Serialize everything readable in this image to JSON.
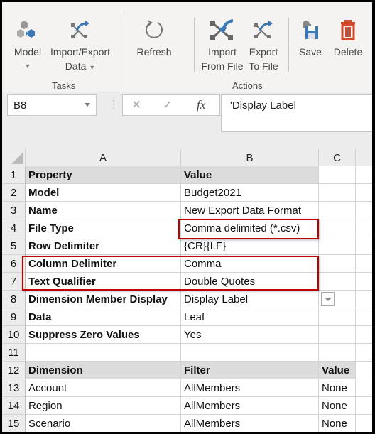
{
  "ribbon": {
    "buttons": [
      {
        "label1": "Model",
        "label2": "",
        "dropdown": true,
        "icon": "cubes-icon"
      },
      {
        "label1": "Import/Export",
        "label2": "Data",
        "dropdown": true,
        "icon": "import-export-icon"
      },
      {
        "label1": "Refresh",
        "label2": "",
        "icon": "refresh-icon"
      },
      {
        "label1": "Import",
        "label2": "From File",
        "icon": "import-file-icon"
      },
      {
        "label1": "Export",
        "label2": "To File",
        "icon": "export-file-icon"
      },
      {
        "label1": "Save",
        "label2": "",
        "icon": "save-icon"
      },
      {
        "label1": "Delete",
        "label2": "",
        "icon": "trash-icon"
      }
    ],
    "groups": [
      "Tasks",
      "Actions"
    ]
  },
  "formula_bar": {
    "name_box": "B8",
    "formula": "'Display Label"
  },
  "columns": [
    "A",
    "B",
    "C"
  ],
  "rows": [
    {
      "n": "1",
      "a": "Property",
      "b": "Value",
      "c": "",
      "header": true
    },
    {
      "n": "2",
      "a": "Model",
      "b": "Budget2021",
      "c": ""
    },
    {
      "n": "3",
      "a": "Name",
      "b": "New Export Data Format",
      "c": ""
    },
    {
      "n": "4",
      "a": "File Type",
      "b": "Comma delimited (*.csv)",
      "c": ""
    },
    {
      "n": "5",
      "a": "Row Delimiter",
      "b": "{CR}{LF}",
      "c": ""
    },
    {
      "n": "6",
      "a": "Column Delimiter",
      "b": "Comma",
      "c": ""
    },
    {
      "n": "7",
      "a": "Text Qualifier",
      "b": "Double Quotes",
      "c": ""
    },
    {
      "n": "8",
      "a": "Dimension Member Display",
      "b": "Display Label",
      "c": ""
    },
    {
      "n": "9",
      "a": "Data",
      "b": "Leaf",
      "c": ""
    },
    {
      "n": "10",
      "a": "Suppress Zero Values",
      "b": "Yes",
      "c": ""
    },
    {
      "n": "11",
      "a": "",
      "b": "",
      "c": ""
    },
    {
      "n": "12",
      "a": "Dimension",
      "b": "Filter",
      "c": "Value",
      "header": true
    },
    {
      "n": "13",
      "a": "Account",
      "b": "AllMembers",
      "c": "None",
      "plain": true
    },
    {
      "n": "14",
      "a": "Region",
      "b": "AllMembers",
      "c": "None",
      "plain": true
    },
    {
      "n": "15",
      "a": "Scenario",
      "b": "AllMembers",
      "c": "None",
      "plain": true
    }
  ],
  "colors": {
    "highlight": "#c00000",
    "accent": "#3c78b5"
  }
}
